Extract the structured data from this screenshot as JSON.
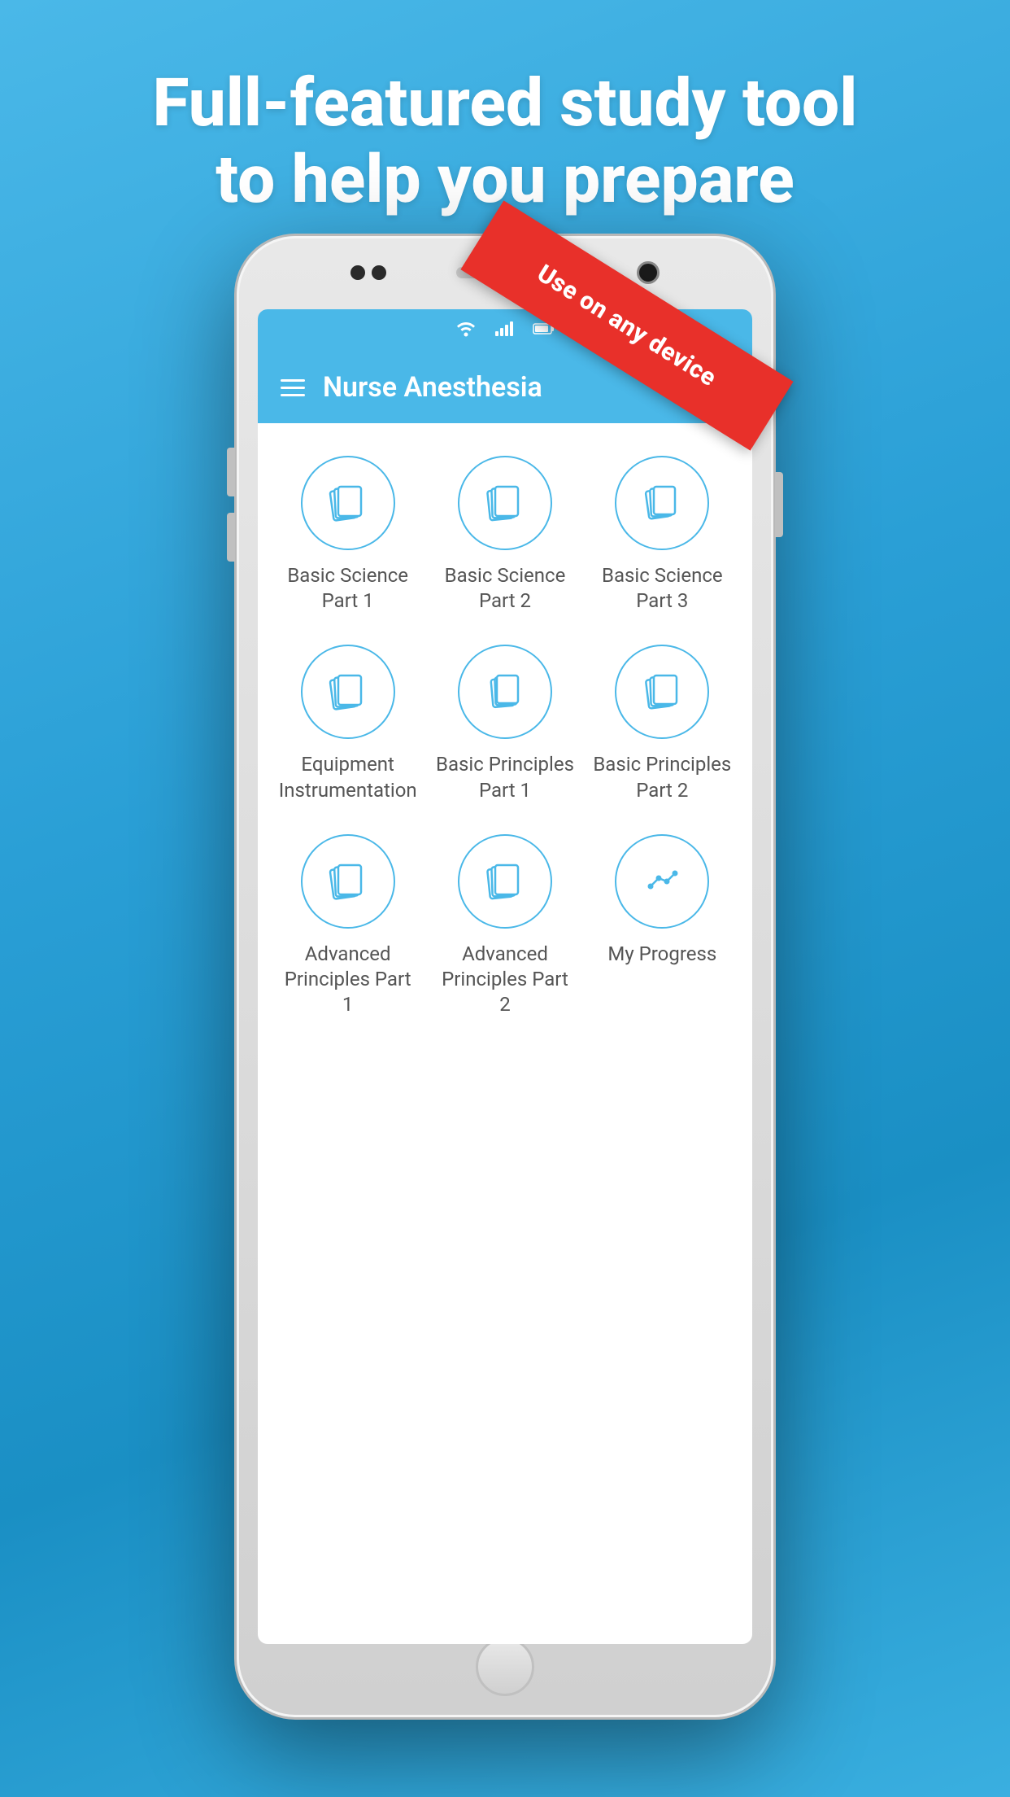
{
  "hero": {
    "line1": "Full-featured study tool",
    "line2": "to help you prepare"
  },
  "ribbon": {
    "text": "Use on any device"
  },
  "app": {
    "title": "Nurse Anesthesia",
    "status_icons": [
      "wifi",
      "signal",
      "battery"
    ]
  },
  "grid": {
    "items": [
      {
        "id": "basic-science-1",
        "label": "Basic Science\nPart 1",
        "icon": "cards"
      },
      {
        "id": "basic-science-2",
        "label": "Basic Science\nPart 2",
        "icon": "cards"
      },
      {
        "id": "basic-science-3",
        "label": "Basic Science\nPart 3",
        "icon": "cards"
      },
      {
        "id": "equipment",
        "label": "Equipment\nInstrumentation",
        "icon": "cards"
      },
      {
        "id": "basic-principles-1",
        "label": "Basic Principles\nPart 1",
        "icon": "cards"
      },
      {
        "id": "basic-principles-2",
        "label": "Basic Principles\nPart 2",
        "icon": "cards"
      },
      {
        "id": "advanced-1",
        "label": "Advanced\nPrinciples Part 1",
        "icon": "cards"
      },
      {
        "id": "advanced-2",
        "label": "Advanced\nPrinciples Part 2",
        "icon": "cards"
      },
      {
        "id": "progress",
        "label": "My Progress",
        "icon": "progress"
      }
    ],
    "labels": [
      "Basic Science Part 1",
      "Basic Science Part 2",
      "Basic Science Part 3",
      "Equipment Instrumentation",
      "Basic Principles Part 1",
      "Basic Principles Part 2",
      "Advanced Principles Part 1",
      "Advanced Principles Part 2",
      "My Progress"
    ]
  },
  "colors": {
    "blue": "#4ab8e8",
    "red": "#e8302a",
    "text_gray": "#555555",
    "white": "#ffffff"
  }
}
